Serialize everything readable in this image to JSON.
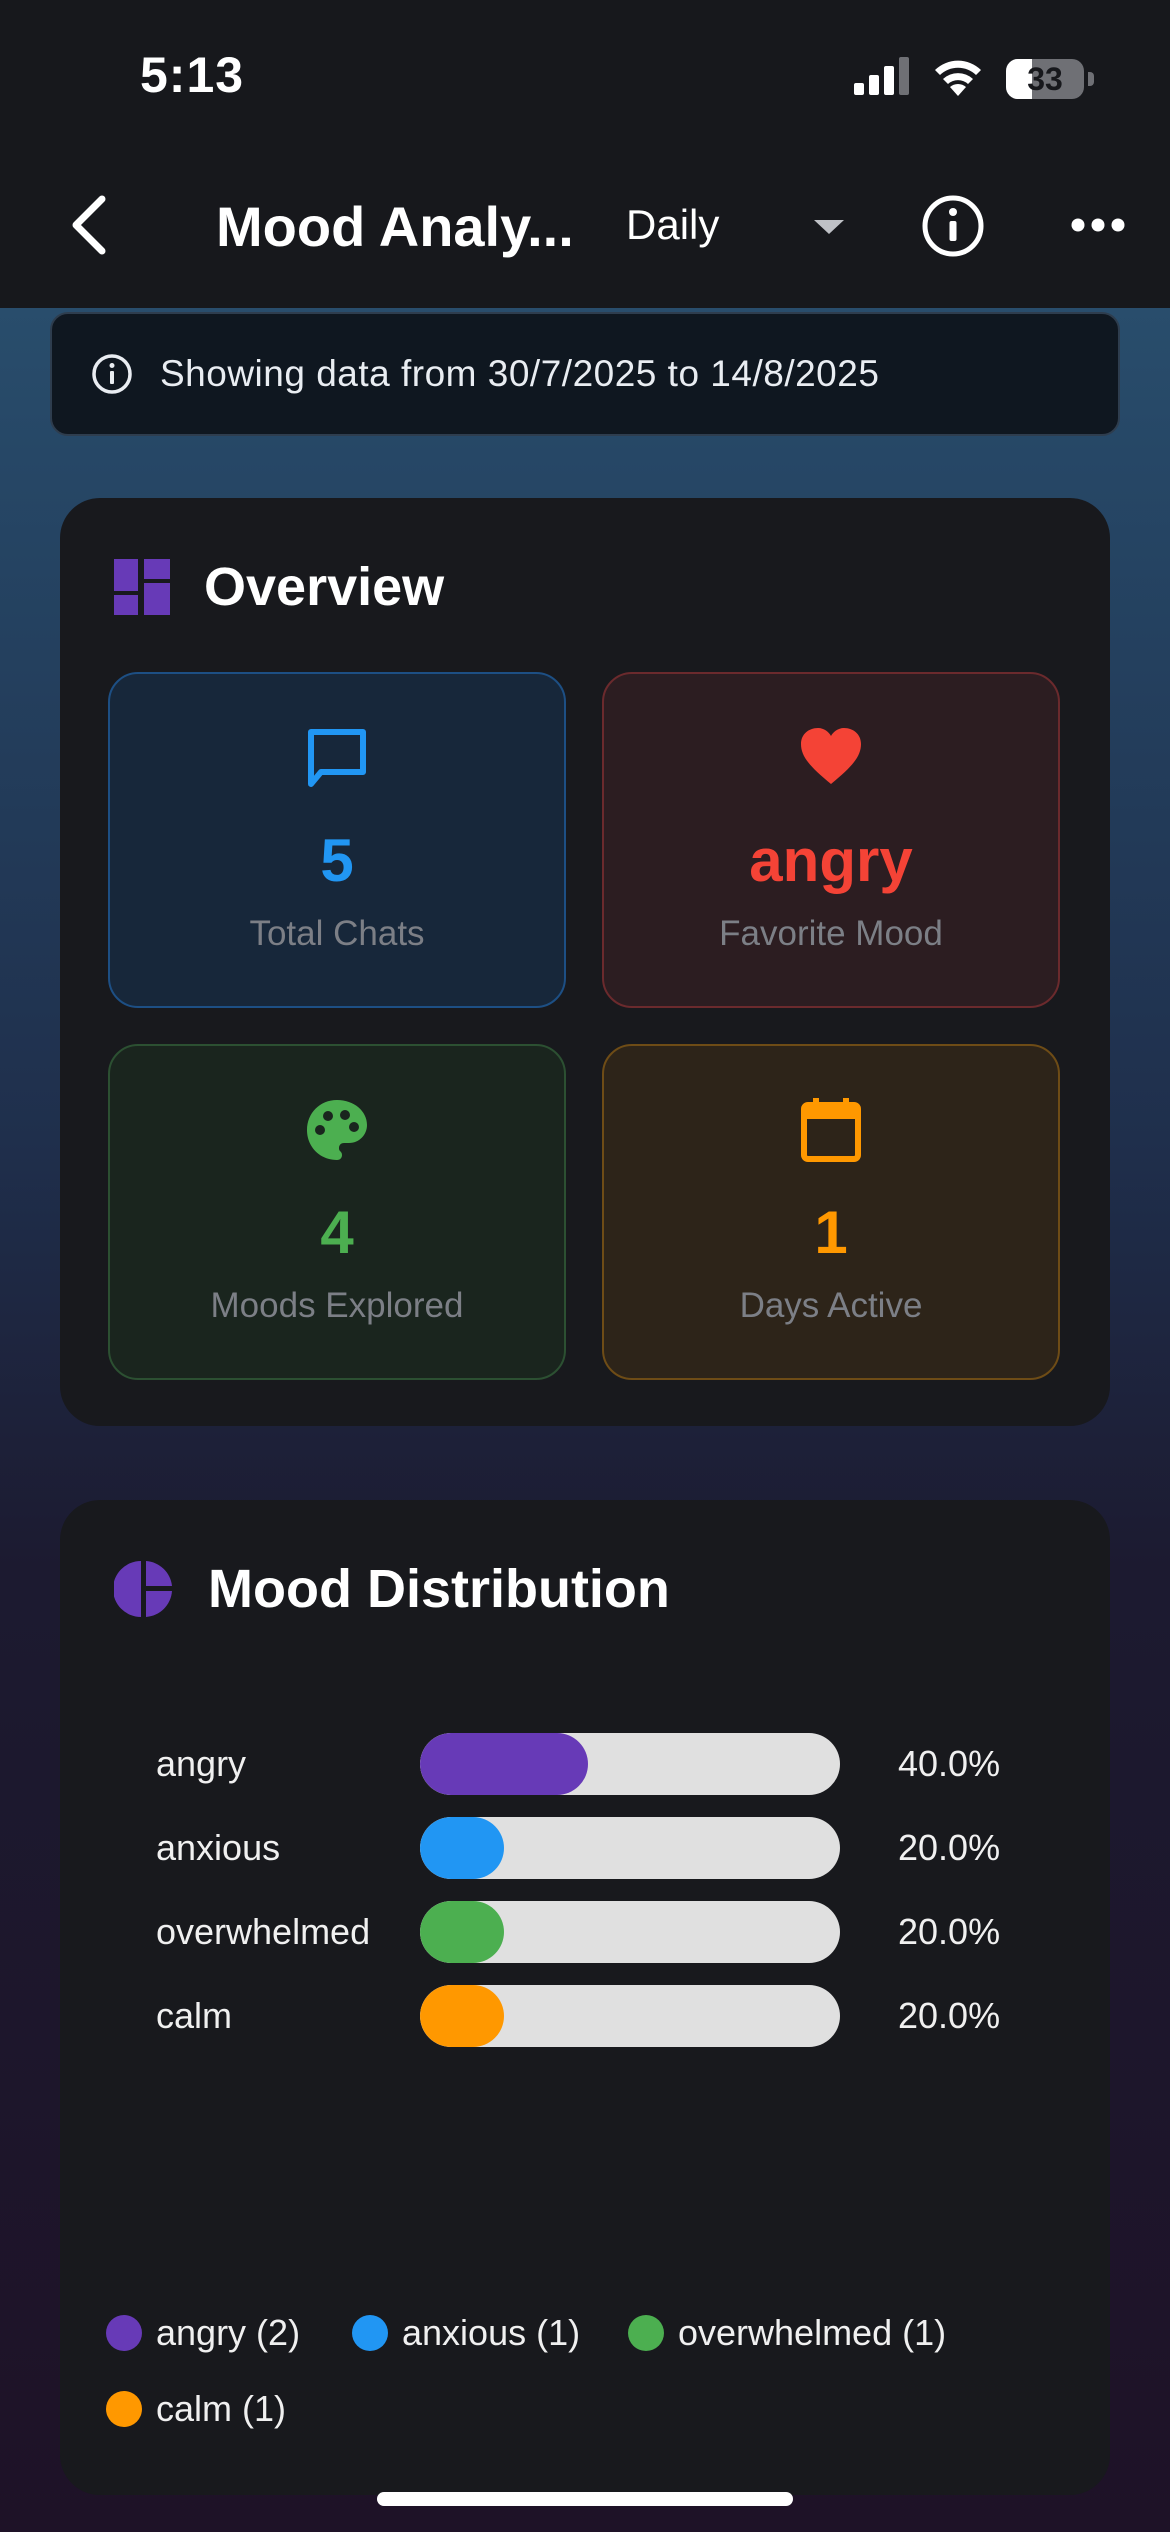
{
  "status_bar": {
    "time": "5:13",
    "battery": "33",
    "battery_level": 0.33
  },
  "nav": {
    "title": "Mood Analy...",
    "period": "Daily"
  },
  "banner": {
    "text": "Showing data from 30/7/2025 to 14/8/2025"
  },
  "overview": {
    "title": "Overview",
    "stats": [
      {
        "value": "5",
        "label": "Total Chats",
        "color": "#2196F3",
        "icon": "chat-bubble-icon"
      },
      {
        "value": "angry",
        "label": "Favorite Mood",
        "color": "#F44336",
        "icon": "heart-icon"
      },
      {
        "value": "4",
        "label": "Moods Explored",
        "color": "#4CAF50",
        "icon": "palette-icon"
      },
      {
        "value": "1",
        "label": "Days Active",
        "color": "#FF9800",
        "icon": "calendar-icon"
      }
    ]
  },
  "distribution": {
    "title": "Mood Distribution",
    "rows": [
      {
        "mood": "angry",
        "percent": "40.0%",
        "fraction": 0.4,
        "color": "#673AB7"
      },
      {
        "mood": "anxious",
        "percent": "20.0%",
        "fraction": 0.2,
        "color": "#2196F3"
      },
      {
        "mood": "overwhelmed",
        "percent": "20.0%",
        "fraction": 0.2,
        "color": "#4CAF50"
      },
      {
        "mood": "calm",
        "percent": "20.0%",
        "fraction": 0.2,
        "color": "#FF9800"
      }
    ],
    "legend": [
      {
        "label": "angry (2)",
        "color": "#673AB7"
      },
      {
        "label": "anxious (1)",
        "color": "#2196F3"
      },
      {
        "label": "overwhelmed (1)",
        "color": "#4CAF50"
      },
      {
        "label": "calm (1)",
        "color": "#FF9800"
      }
    ]
  },
  "colors": {
    "accent": "#673AB7",
    "background": "#17181c"
  }
}
